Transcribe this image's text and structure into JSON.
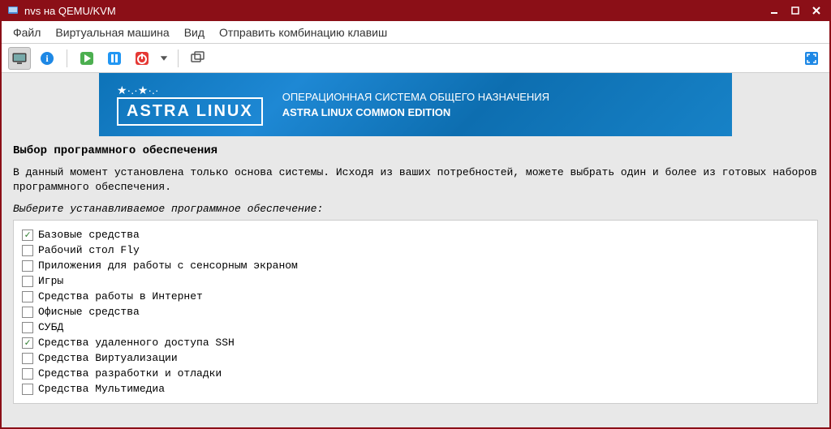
{
  "titlebar": {
    "title": "nvs на QEMU/KVM"
  },
  "menubar": {
    "items": [
      "Файл",
      "Виртуальная машина",
      "Вид",
      "Отправить комбинацию клавиш"
    ]
  },
  "banner": {
    "logo_text": "ASTRA LINUX",
    "line1": "ОПЕРАЦИОННАЯ СИСТЕМА ОБЩЕГО НАЗНАЧЕНИЯ",
    "line2": "ASTRA LINUX COMMON EDITION"
  },
  "section": {
    "title": "Выбор программного обеспечения",
    "description": "В данный момент установлена только основа системы. Исходя из ваших потребностей, можете выбрать один и более из готовых наборов программного обеспечения.",
    "list_header": "Выберите устанавливаемое программное обеспечение:"
  },
  "software": {
    "items": [
      {
        "label": "Базовые средства",
        "checked": true
      },
      {
        "label": "Рабочий стол Fly",
        "checked": false
      },
      {
        "label": "Приложения для работы с сенсорным экраном",
        "checked": false
      },
      {
        "label": "Игры",
        "checked": false
      },
      {
        "label": "Средства работы в Интернет",
        "checked": false
      },
      {
        "label": "Офисные средства",
        "checked": false
      },
      {
        "label": "СУБД",
        "checked": false
      },
      {
        "label": "Средства удаленного доступа SSH",
        "checked": true
      },
      {
        "label": "Средства Виртуализации",
        "checked": false
      },
      {
        "label": "Средства разработки и отладки",
        "checked": false
      },
      {
        "label": "Средства Мультимедиа",
        "checked": false
      }
    ]
  }
}
